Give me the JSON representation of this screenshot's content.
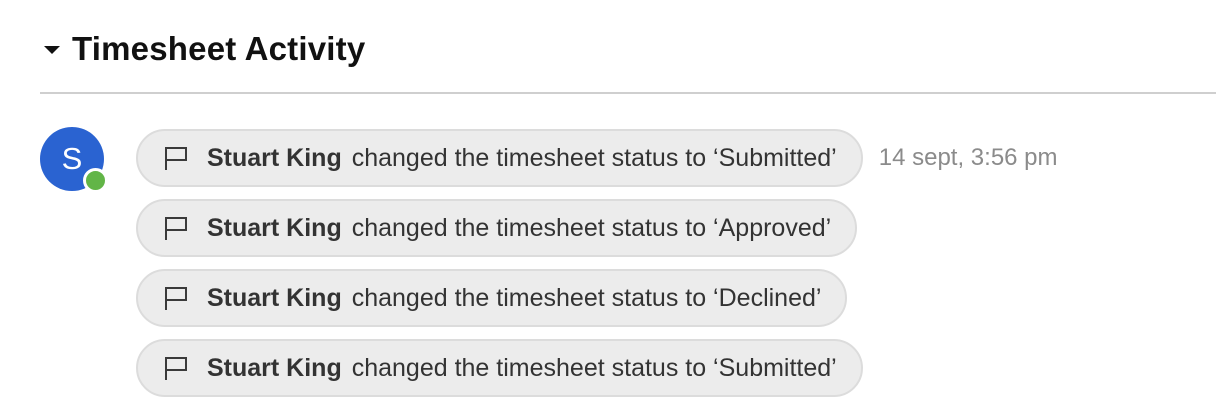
{
  "section": {
    "title": "Timesheet Activity",
    "collapse_icon": "caret-down-icon"
  },
  "user": {
    "initial": "S",
    "avatar_color": "#2a63d1",
    "presence_color": "#62b547"
  },
  "activities": [
    {
      "icon": "flag-icon",
      "actor": "Stuart King",
      "action": "changed the timesheet status to ‘Submitted’",
      "timestamp": "14 sept, 3:56 pm"
    },
    {
      "icon": "flag-icon",
      "actor": "Stuart King",
      "action": "changed the timesheet status to ‘Approved’"
    },
    {
      "icon": "flag-icon",
      "actor": "Stuart King",
      "action": "changed the timesheet status to ‘Declined’"
    },
    {
      "icon": "flag-icon",
      "actor": "Stuart King",
      "action": "changed the timesheet status to ‘Submitted’"
    }
  ]
}
